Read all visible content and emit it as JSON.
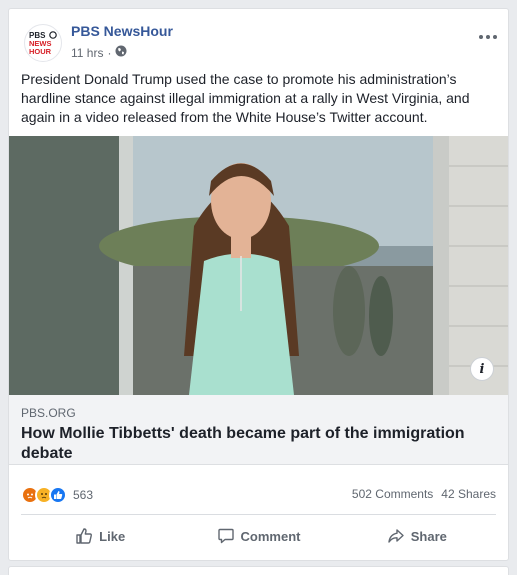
{
  "post": {
    "page_name": "PBS NewsHour",
    "logo_lines": [
      "PBS",
      "NEWS",
      "HOUR"
    ],
    "time": "11 hrs",
    "time_separator": "·",
    "audience_icon": "globe-icon",
    "menu_icon": "more-dots-icon",
    "text": "President Donald Trump used the case to promote his administration’s hardline stance against illegal immigration at a rally in West Virginia, and again in a video released from the White House’s Twitter account."
  },
  "link": {
    "domain": "PBS.ORG",
    "headline": "How Mollie Tibbetts' death became part of the immigration debate",
    "info_label": "i"
  },
  "stats": {
    "reaction_icons": [
      "angry-reaction-icon",
      "sad-reaction-icon",
      "like-reaction-icon"
    ],
    "reaction_count": "563",
    "comments": "502 Comments",
    "shares": "42 Shares"
  },
  "actions": {
    "like_label": "Like",
    "comment_label": "Comment",
    "share_label": "Share"
  },
  "colors": {
    "page_name": "#365899",
    "like_blue": "#1877f2",
    "pbs_red": "#d61f26",
    "background": "#e9ebee"
  }
}
